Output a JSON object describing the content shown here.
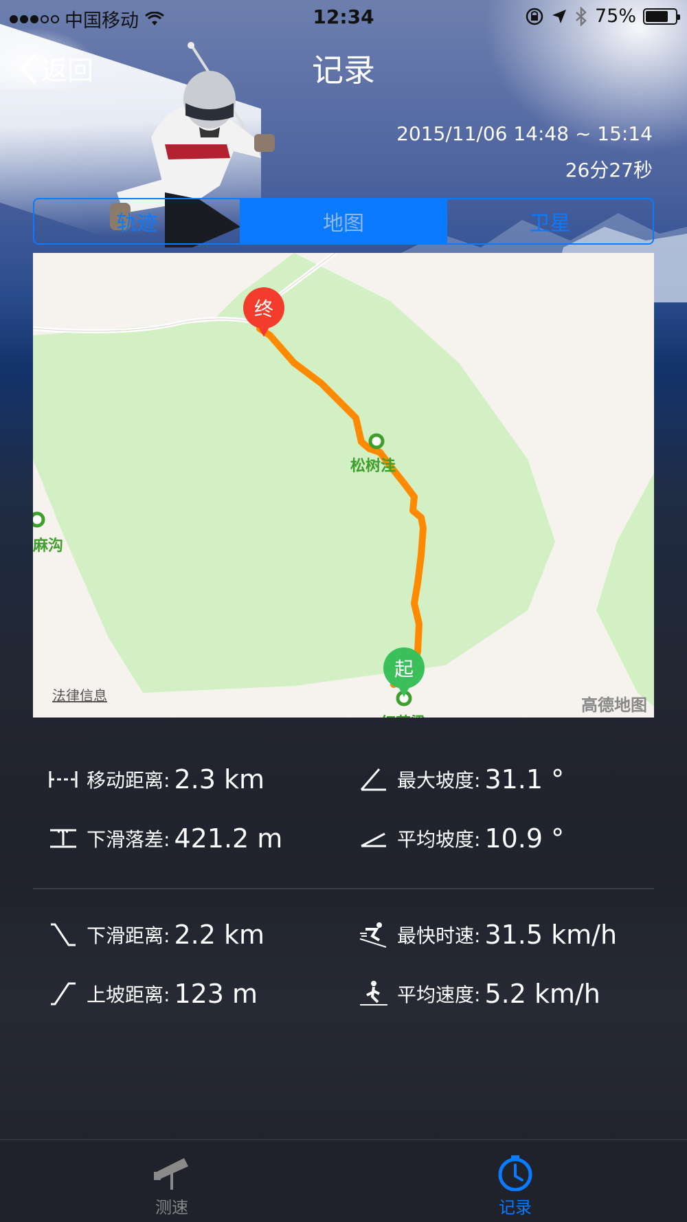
{
  "status_bar": {
    "carrier": "中国移动",
    "time": "12:34",
    "battery": "75%",
    "battery_level": 0.75
  },
  "nav": {
    "back_label": "返回",
    "title": "记录"
  },
  "record": {
    "time_range": "2015/11/06 14:48 ~ 15:14",
    "duration": "26分27秒"
  },
  "segments": {
    "items": [
      "轨迹",
      "地图",
      "卫星"
    ],
    "active_index": 1
  },
  "map": {
    "end_marker": "终",
    "start_marker": "起",
    "poi_1": "松树洼",
    "poi_2": "麻沟",
    "poi_3": "红花梁",
    "legal": "法律信息",
    "brand": "高德地图",
    "track_color": "#ff8a00"
  },
  "stats": {
    "move_distance": {
      "label": "移动距离:",
      "value": "2.3 km"
    },
    "max_slope": {
      "label": "最大坡度:",
      "value": "31.1 °"
    },
    "drop": {
      "label": "下滑落差:",
      "value": "421.2 m"
    },
    "avg_slope": {
      "label": "平均坡度:",
      "value": "10.9 °"
    },
    "downhill_distance": {
      "label": "下滑距离:",
      "value": "2.2 km"
    },
    "max_speed": {
      "label": "最快时速:",
      "value": "31.5 km/h"
    },
    "uphill_distance": {
      "label": "上坡距离:",
      "value": "123 m"
    },
    "avg_speed": {
      "label": "平均速度:",
      "value": "5.2 km/h"
    }
  },
  "tab_bar": {
    "speed_label": "测速",
    "record_label": "记录",
    "active": "record"
  },
  "colors": {
    "accent": "#0a7aff",
    "end_pin": "#f43c2c",
    "start_pin": "#3bbf5b"
  }
}
